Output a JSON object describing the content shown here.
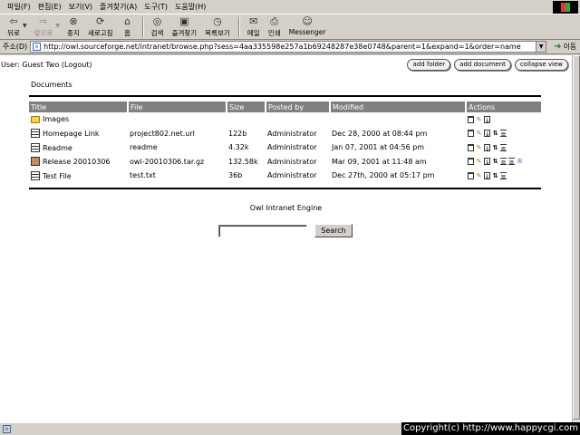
{
  "menu": [
    "파일(F)",
    "편집(E)",
    "보기(V)",
    "즐겨찾기(A)",
    "도구(T)",
    "도움말(H)"
  ],
  "toolbar": {
    "back": "뒤로",
    "forward": "앞으로",
    "stop": "중지",
    "refresh": "새로고침",
    "home": "홈",
    "search": "검색",
    "favorites": "즐겨찾기",
    "history": "목록보기",
    "mail": "메일",
    "print": "인쇄",
    "messenger": "Messenger"
  },
  "address": {
    "label": "주소(D)",
    "url": "http://owl.sourceforge.net/intranet/browse.php?sess=4aa335598e257a1b69248287e38e0748&parent=1&expand=1&order=name",
    "go_label": "이동"
  },
  "user": {
    "text": "User: Guest Two (Logout)"
  },
  "top_buttons": {
    "add_folder": "add folder",
    "add_document": "add document",
    "collapse_view": "collapse view"
  },
  "section_title": "Documents",
  "columns": {
    "title": "Title",
    "file": "File",
    "size": "Size",
    "posted_by": "Posted by",
    "modified": "Modified",
    "actions": "Actions"
  },
  "rows": [
    {
      "icon": "folder-icon",
      "title": "Images",
      "file": "",
      "size": "",
      "posted_by": "",
      "modified": ""
    },
    {
      "icon": "document-icon",
      "title": "Homepage Link",
      "file": "project802.net.url",
      "size": "122b",
      "posted_by": "Administrator",
      "modified": "Dec 28, 2000 at 08:44 pm"
    },
    {
      "icon": "document-icon",
      "title": "Readme",
      "file": "readme",
      "size": "4.32k",
      "posted_by": "Administrator",
      "modified": "Jan 07, 2001 at 04:56 pm"
    },
    {
      "icon": "package-icon",
      "title": "Release 20010306",
      "file": "owl-20010306.tar.gz",
      "size": "132.58k",
      "posted_by": "Administrator",
      "modified": "Mar 09, 2001 at 11:48 am"
    },
    {
      "icon": "document-icon",
      "title": "Test File",
      "file": "test.txt",
      "size": "36b",
      "posted_by": "Administrator",
      "modified": "Dec 27th, 2000 at 05:17 pm"
    }
  ],
  "footer": {
    "engine": "Owl Intranet Engine",
    "search_value": "",
    "search_button": "Search"
  },
  "copyright": "Copyright(c) http://www.happycgi.com"
}
